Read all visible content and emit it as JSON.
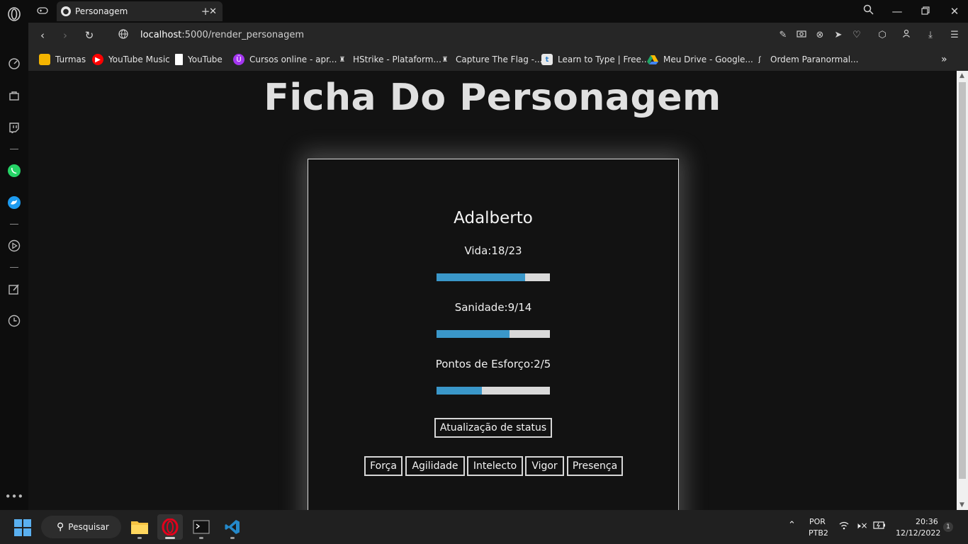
{
  "browser": {
    "tab_title": "Personagem",
    "url_host": "localhost",
    "url_path": ":5000/render_personagem"
  },
  "bookmarks": [
    {
      "label": "Turmas",
      "icon": "google-classroom-icon",
      "color": "#f4b400"
    },
    {
      "label": "YouTube Music",
      "icon": "youtube-music-icon",
      "color": "#ff0000"
    },
    {
      "label": "YouTube",
      "icon": "document-icon",
      "color": "#ffffff"
    },
    {
      "label": "Cursos online - apr...",
      "icon": "udemy-icon",
      "color": "#a435f0"
    },
    {
      "label": "HStrike - Plataform...",
      "icon": "hstrike-icon",
      "color": "#dddddd"
    },
    {
      "label": "Capture The Flag -...",
      "icon": "ctf-icon",
      "color": "#dddddd"
    },
    {
      "label": "Learn to Type | Free...",
      "icon": "typing-icon",
      "color": "#2f80c9"
    },
    {
      "label": "Meu Drive - Google...",
      "icon": "google-drive-icon",
      "color": "#1fa463"
    },
    {
      "label": "Ordem Paranormal...",
      "icon": "ordem-paranormal-icon",
      "color": "#ffffff"
    }
  ],
  "page": {
    "title": "Ficha Do Personagem",
    "character_name": "Adalberto",
    "stats": [
      {
        "label": "Vida:18/23",
        "current": 18,
        "max": 23
      },
      {
        "label": "Sanidade:9/14",
        "current": 9,
        "max": 14
      },
      {
        "label": "Pontos de Esforço:2/5",
        "current": 2,
        "max": 5
      }
    ],
    "update_button": "Atualização de status",
    "attributes": [
      "Força",
      "Agilidade",
      "Intelecto",
      "Vigor",
      "Presença"
    ]
  },
  "colors": {
    "bar_fill": "#3a97c9",
    "bar_track": "#d9d9d9",
    "page_bg": "#121212"
  },
  "taskbar": {
    "search_label": "Pesquisar",
    "language": "POR",
    "keyboard": "PTB2",
    "time": "20:36",
    "date": "12/12/2022",
    "notification_count": "1"
  }
}
